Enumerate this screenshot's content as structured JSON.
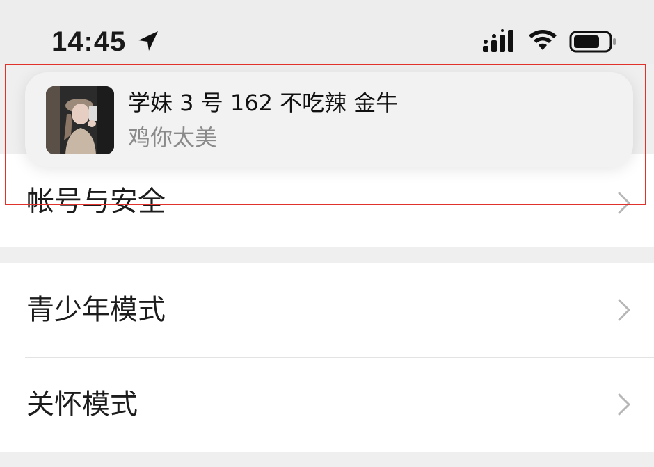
{
  "status_bar": {
    "time": "14:45"
  },
  "notification": {
    "title": "学妹 3 号 162 不吃辣 金牛",
    "message": "鸡你太美"
  },
  "settings": {
    "group1": [
      {
        "label": "帐号与安全"
      }
    ],
    "group2": [
      {
        "label": "青少年模式"
      },
      {
        "label": "关怀模式"
      }
    ]
  },
  "colors": {
    "highlight": "#e0312b",
    "background": "#efefef"
  },
  "icons": [
    "location-arrow-icon",
    "cellular-signal-icon",
    "wifi-icon",
    "battery-icon",
    "chevron-right-icon"
  ]
}
